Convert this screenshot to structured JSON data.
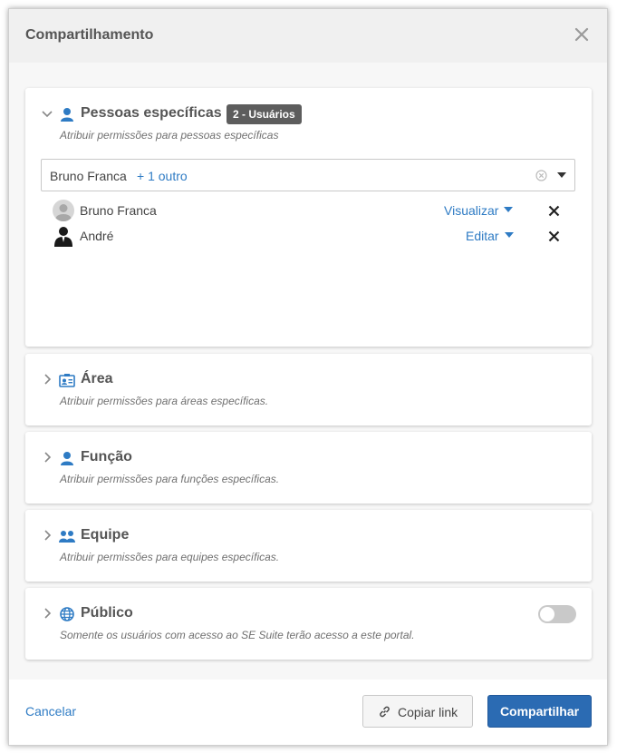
{
  "dialog": {
    "title": "Compartilhamento",
    "close_icon": "close-icon"
  },
  "sections": {
    "pessoas": {
      "title": "Pessoas específicas",
      "badge": "2 - Usuários",
      "description": "Atribuir permissões para pessoas específicas",
      "expanded": true,
      "selector": {
        "value": "Bruno Franca",
        "more": "+ 1 outro"
      },
      "users": [
        {
          "name": "Bruno Franca",
          "permission": "Visualizar",
          "avatar": "default-avatar-icon"
        },
        {
          "name": "André",
          "permission": "Editar",
          "avatar": "businessman-avatar-icon"
        }
      ]
    },
    "area": {
      "title": "Área",
      "description": "Atribuir permissões para áreas específicas.",
      "icon": "id-card-icon"
    },
    "funcao": {
      "title": "Função",
      "description": "Atribuir permissões para funções específicas.",
      "icon": "person-icon"
    },
    "equipe": {
      "title": "Equipe",
      "description": "Atribuir permissões para equipes específicas.",
      "icon": "group-icon"
    },
    "publico": {
      "title": "Público",
      "description": "Somente os usuários com acesso ao SE Suite terão acesso a este portal.",
      "icon": "globe-icon",
      "toggle_on": false
    }
  },
  "footer": {
    "cancel_label": "Cancelar",
    "copy_link_label": "Copiar link",
    "share_label": "Compartilhar"
  },
  "colors": {
    "accent": "#2e7bc4",
    "primary_button": "#2b6bb3",
    "badge": "#5d5d5d"
  }
}
